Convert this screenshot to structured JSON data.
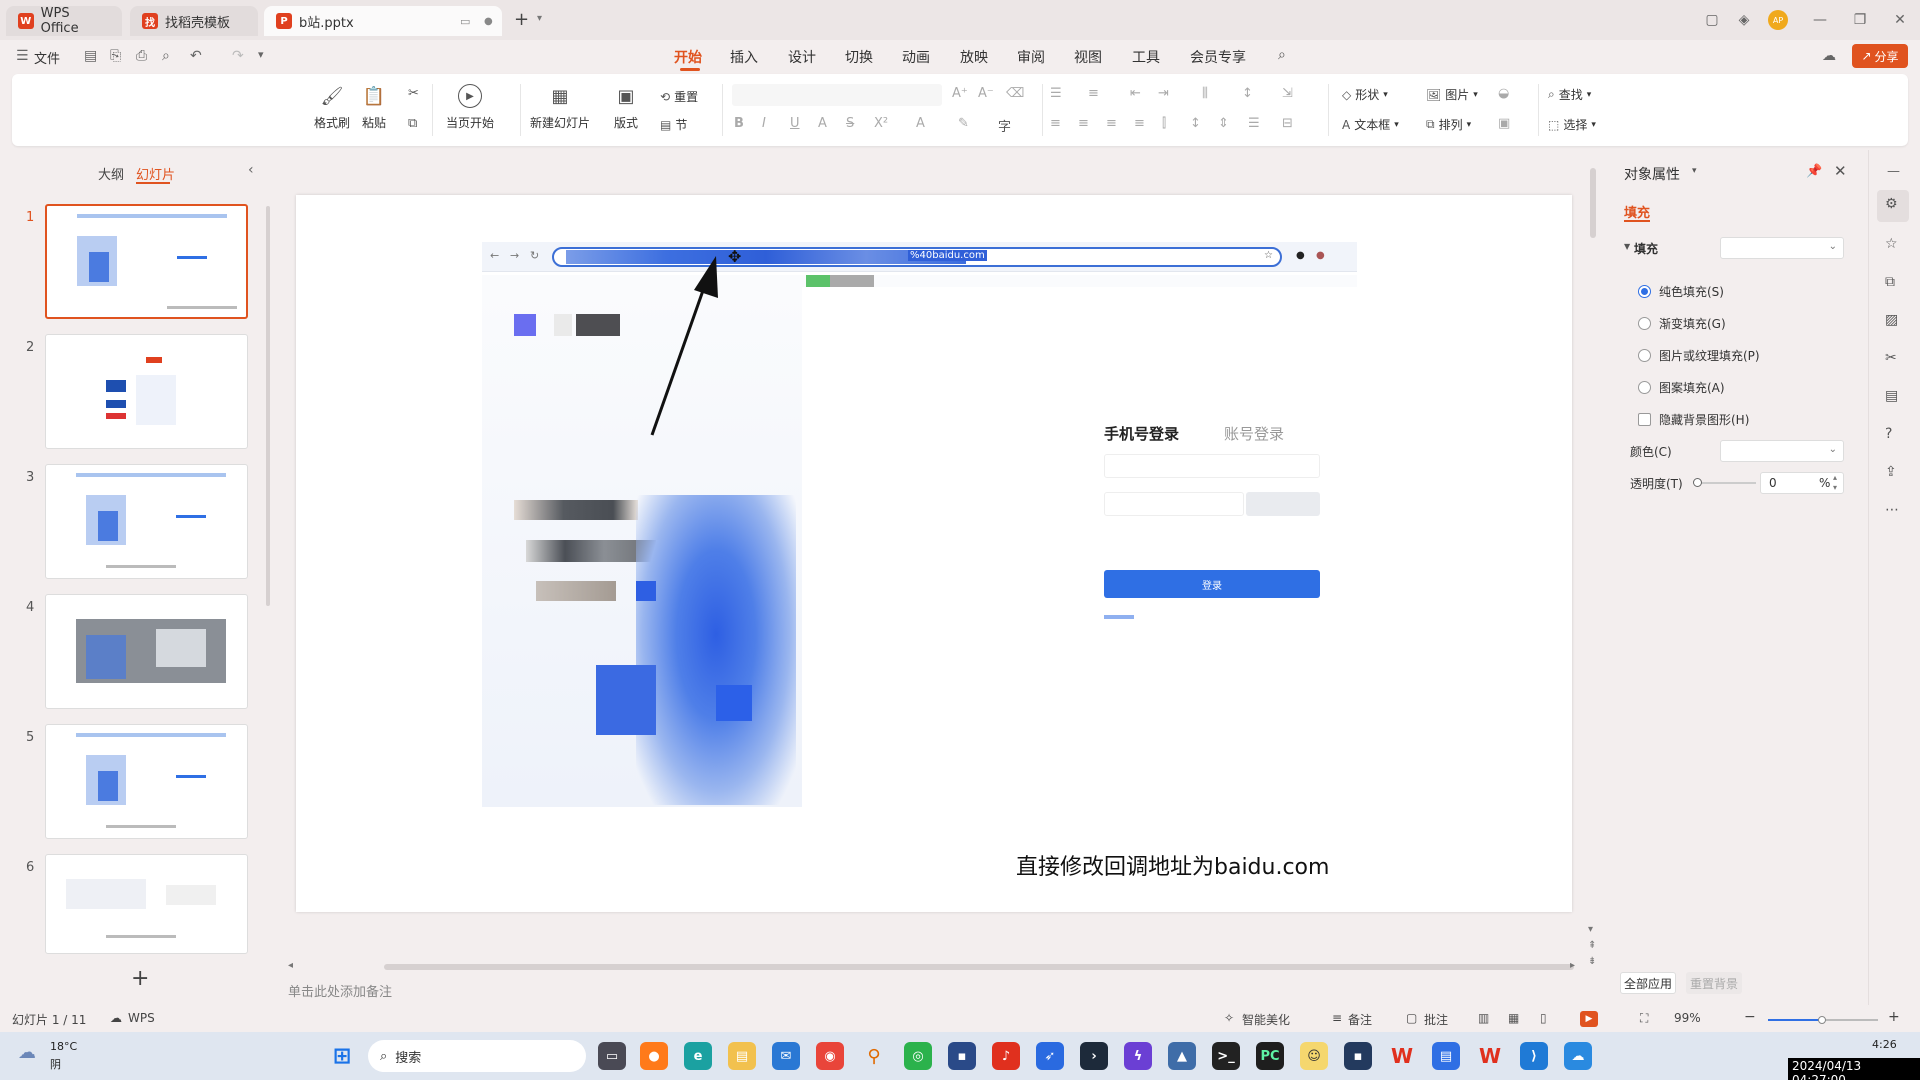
{
  "tabs": [
    {
      "label": "WPS Office",
      "logo": "W"
    },
    {
      "label": "找稻壳模板",
      "logo": "找"
    },
    {
      "label": "b站.pptx",
      "logo": "P"
    }
  ],
  "menu": {
    "file": "文件",
    "items": [
      "开始",
      "插入",
      "设计",
      "切换",
      "动画",
      "放映",
      "审阅",
      "视图",
      "工具",
      "会员专享"
    ],
    "active": "开始",
    "share": "分享",
    "avatar_text": "AP"
  },
  "ribbon": {
    "format_painter": "格式刷",
    "paste": "粘贴",
    "from_current": "当页开始",
    "new_slide": "新建幻灯片",
    "layout": "版式",
    "reset": "重置",
    "section": "节",
    "shape": "形状",
    "picture": "图片",
    "textbox": "文本框",
    "arrange": "排列",
    "find": "查找",
    "select": "选择"
  },
  "left_panel": {
    "outline_tab": "大纲",
    "slides_tab": "幻灯片",
    "slide_numbers": [
      "1",
      "2",
      "3",
      "4",
      "5",
      "6"
    ],
    "add_label": "+"
  },
  "slide": {
    "caption": "直接修改回调地址为baidu.com",
    "login": {
      "phone_login": "手机号登录",
      "account_login": "账号登录",
      "login_button": "登录"
    },
    "url_fragment": "%40baidu.com"
  },
  "notes_placeholder": "单击此处添加备注",
  "right_panel": {
    "title": "对象属性",
    "tab": "填充",
    "section": "填充",
    "options": [
      "纯色填充(S)",
      "渐变填充(G)",
      "图片或纹理填充(P)",
      "图案填充(A)"
    ],
    "hide_bg": "隐藏背景图形(H)",
    "color_label": "颜色(C)",
    "transparency_label": "透明度(T)",
    "transparency_value": "0",
    "percent": "%",
    "apply_all": "全部应用",
    "reset_bg": "重置背景"
  },
  "status": {
    "slide_counter": "幻灯片 1 / 11",
    "wps": "WPS",
    "beautify": "智能美化",
    "notes": "备注",
    "comments": "批注",
    "zoom": "99%"
  },
  "taskbar": {
    "weather_temp": "18°C",
    "weather_desc": "阴",
    "search": "搜索",
    "time": "4:26",
    "datetime": "2024/04/13 04:27:00"
  },
  "colors": {
    "accent": "#e0531f",
    "blue_button": "#2f6fe4",
    "tab_bar": "#ece6e6"
  }
}
